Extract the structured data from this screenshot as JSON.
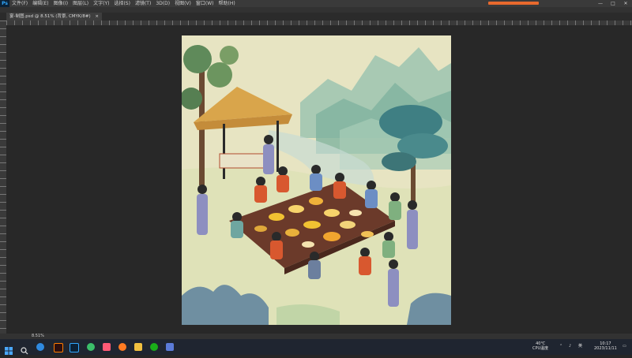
{
  "app": {
    "logo": "Ps"
  },
  "menu": [
    "文件(F)",
    "编辑(E)",
    "图像(I)",
    "图层(L)",
    "文字(Y)",
    "选择(S)",
    "滤镜(T)",
    "3D(D)",
    "视图(V)",
    "窗口(W)",
    "帮助(H)"
  ],
  "window_controls": {
    "minimize": "—",
    "maximize": "□",
    "close": "✕"
  },
  "document_tab": {
    "title": "宴-制图.psd @ 8.51% (背景, CMYK/8#)",
    "close": "×"
  },
  "status": {
    "zoom": "8.51%"
  },
  "tray": {
    "temp": "40℃",
    "cpu": "CPU温度",
    "lang": "英",
    "time": "10:17",
    "date": "2023/11/11"
  },
  "colors": {
    "accent": "#e8692d",
    "ps_blue": "#31a8ff",
    "taskbar": "#1f2530"
  }
}
